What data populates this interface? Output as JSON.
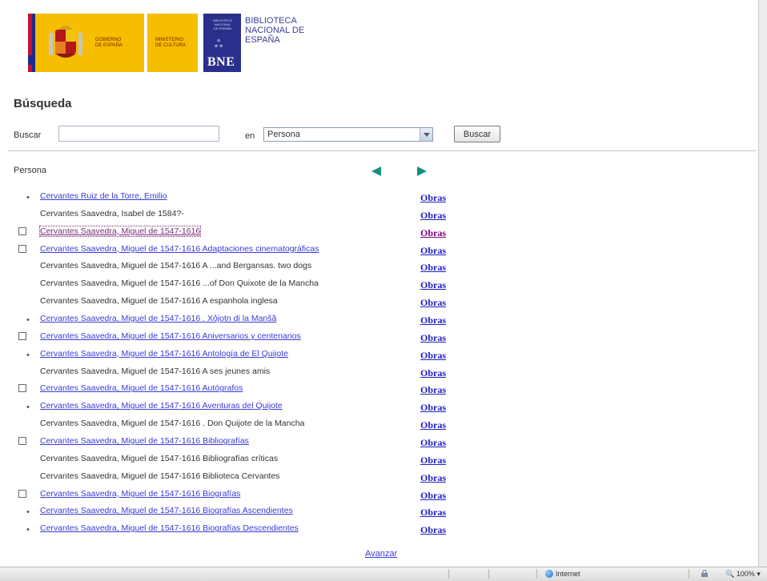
{
  "header": {
    "gobierno": "GOBIERNO\nDE ESPAÑA",
    "ministerio": "MINISTERIO\nDE CULTURA",
    "bne_mini": "BIBLIOTECA\nNACIONAL\nDE ESPAÑA",
    "bne_short": "BNE",
    "bne_title": "BIBLIOTECA\nNACIONAL DE\nESPAÑA"
  },
  "search": {
    "heading": "Búsqueda",
    "label": "Buscar",
    "query": "",
    "in_label": "en",
    "field_selected": "Persona",
    "button": "Buscar"
  },
  "results": {
    "column_header": "Persona",
    "works_label": "Obras",
    "next_label": "Avanzar",
    "items": [
      {
        "text": "Cervantes Ruiz de la Torre, Emilio",
        "marker": "bullet",
        "style": "link"
      },
      {
        "text": "Cervantes Saavedra, Isabel de 1584?-",
        "marker": "none",
        "style": "plain"
      },
      {
        "text": "Cervantes Saavedra, Miguel de 1547-1616",
        "marker": "checkbox",
        "style": "visited"
      },
      {
        "text": "Cervantes Saavedra, Miguel de 1547-1616 Adaptaciones cinematográficas",
        "marker": "checkbox",
        "style": "link"
      },
      {
        "text": "Cervantes Saavedra, Miguel de 1547-1616 A ...and Bergansas. two dogs",
        "marker": "none",
        "style": "plain"
      },
      {
        "text": "Cervantes Saavedra, Miguel de 1547-1616 ...of Don Quixote de la Mancha",
        "marker": "none",
        "style": "plain"
      },
      {
        "text": "Cervantes Saavedra, Miguel de 1547-1616 A espanhola inglesa",
        "marker": "none",
        "style": "plain"
      },
      {
        "text": "Cervantes Saavedra, Miguel de 1547-1616 . Xôjotn di la Manšã",
        "marker": "bullet",
        "style": "link"
      },
      {
        "text": "Cervantes Saavedra, Miguel de 1547-1616 Aniversarios y centenarios",
        "marker": "checkbox",
        "style": "link"
      },
      {
        "text": "Cervantes Saavedra, Miguel de 1547-1616 Antología de El Quijote",
        "marker": "bullet",
        "style": "link"
      },
      {
        "text": "Cervantes Saavedra, Miguel de 1547-1616 A ses jeunes amis",
        "marker": "none",
        "style": "plain"
      },
      {
        "text": "Cervantes Saavedra, Miguel de 1547-1616 Autógrafos",
        "marker": "checkbox",
        "style": "link"
      },
      {
        "text": "Cervantes Saavedra, Miguel de 1547-1616 Aventuras del Quijote",
        "marker": "bullet",
        "style": "link"
      },
      {
        "text": "Cervantes Saavedra, Miguel de 1547-1616 . Don Quijote de la Mancha",
        "marker": "none",
        "style": "plain"
      },
      {
        "text": "Cervantes Saavedra, Miguel de 1547-1616 Bibliografías",
        "marker": "checkbox",
        "style": "link"
      },
      {
        "text": "Cervantes Saavedra, Miguel de 1547-1616 Bibliografías críticas",
        "marker": "none",
        "style": "plain"
      },
      {
        "text": "Cervantes Saavedra, Miguel de 1547-1616 Biblioteca Cervantes",
        "marker": "none",
        "style": "plain"
      },
      {
        "text": "Cervantes Saavedra, Miguel de 1547-1616 Biografías",
        "marker": "checkbox",
        "style": "link"
      },
      {
        "text": "Cervantes Saavedra, Miguel de 1547-1616 Biografías Ascendientes",
        "marker": "bullet",
        "style": "link"
      },
      {
        "text": "Cervantes Saavedra, Miguel de 1547-1616 Biografías Descendientes",
        "marker": "bullet",
        "style": "link"
      }
    ]
  },
  "statusbar": {
    "zone": "Internet",
    "zoom": "100%"
  },
  "colors": {
    "link": "#3a3ad6",
    "visited": "#7a2a7a",
    "nav_arrow": "#159080",
    "gov_yellow": "#f5be00",
    "bne_blue": "#2b2f8c"
  },
  "icons": {
    "prev": "arrow-left-icon",
    "next": "arrow-right-icon",
    "zone": "globe-icon",
    "security": "security-icon"
  }
}
